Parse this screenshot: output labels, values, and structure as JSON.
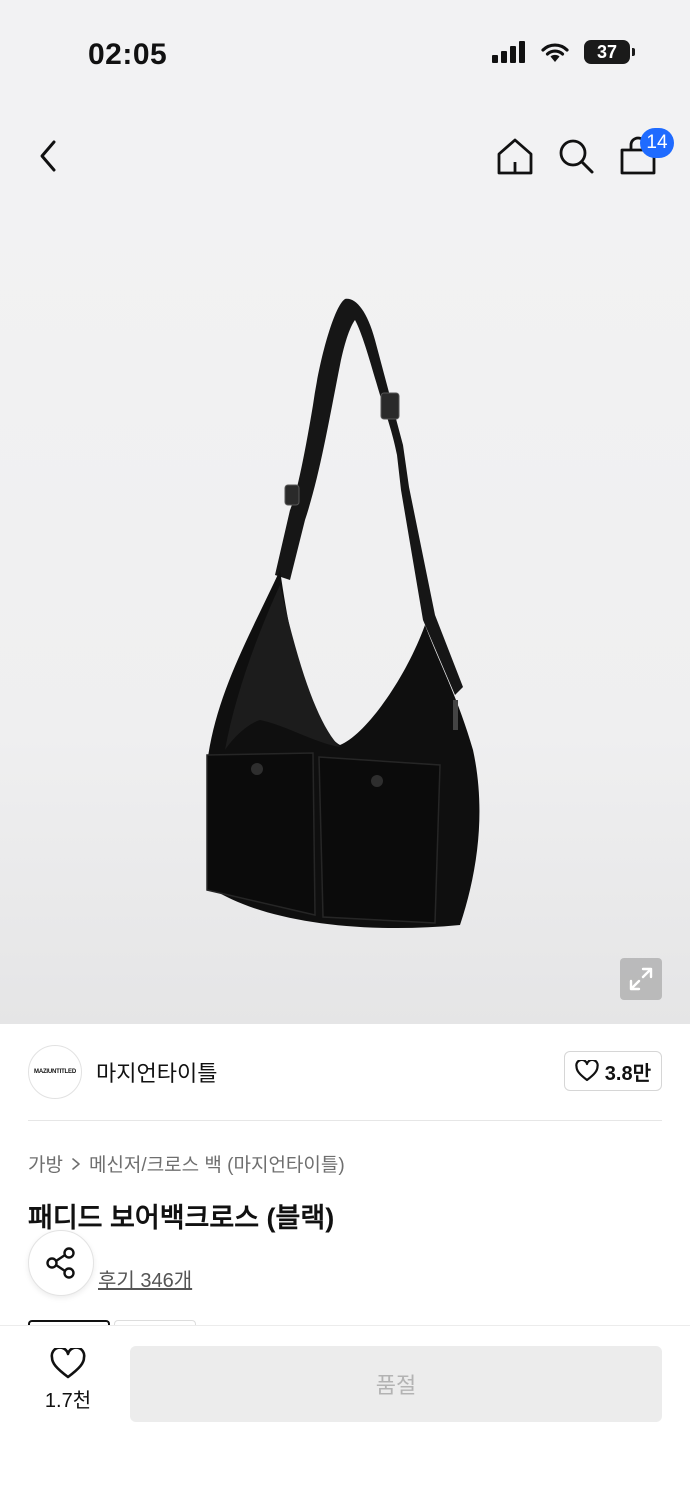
{
  "status_bar": {
    "time": "02:05",
    "battery": "37"
  },
  "nav": {
    "cart_count": "14"
  },
  "brand": {
    "logo_text": "MAZIUNTITLED",
    "name": "마지언타이틀",
    "likes": "3.8만"
  },
  "breadcrumb": {
    "items": [
      "가방",
      "메신저/크로스 백 (마지언타이틀)"
    ]
  },
  "product": {
    "title": "패디드 보어백크로스 (블랙)",
    "reviews": "후기 346개"
  },
  "bottom_bar": {
    "wish_count": "1.7천",
    "soldout_label": "품절"
  },
  "colors": {
    "accent_blue": "#1f6bff",
    "soldout_bg": "#ececec",
    "soldout_text": "#b3b3b3"
  }
}
